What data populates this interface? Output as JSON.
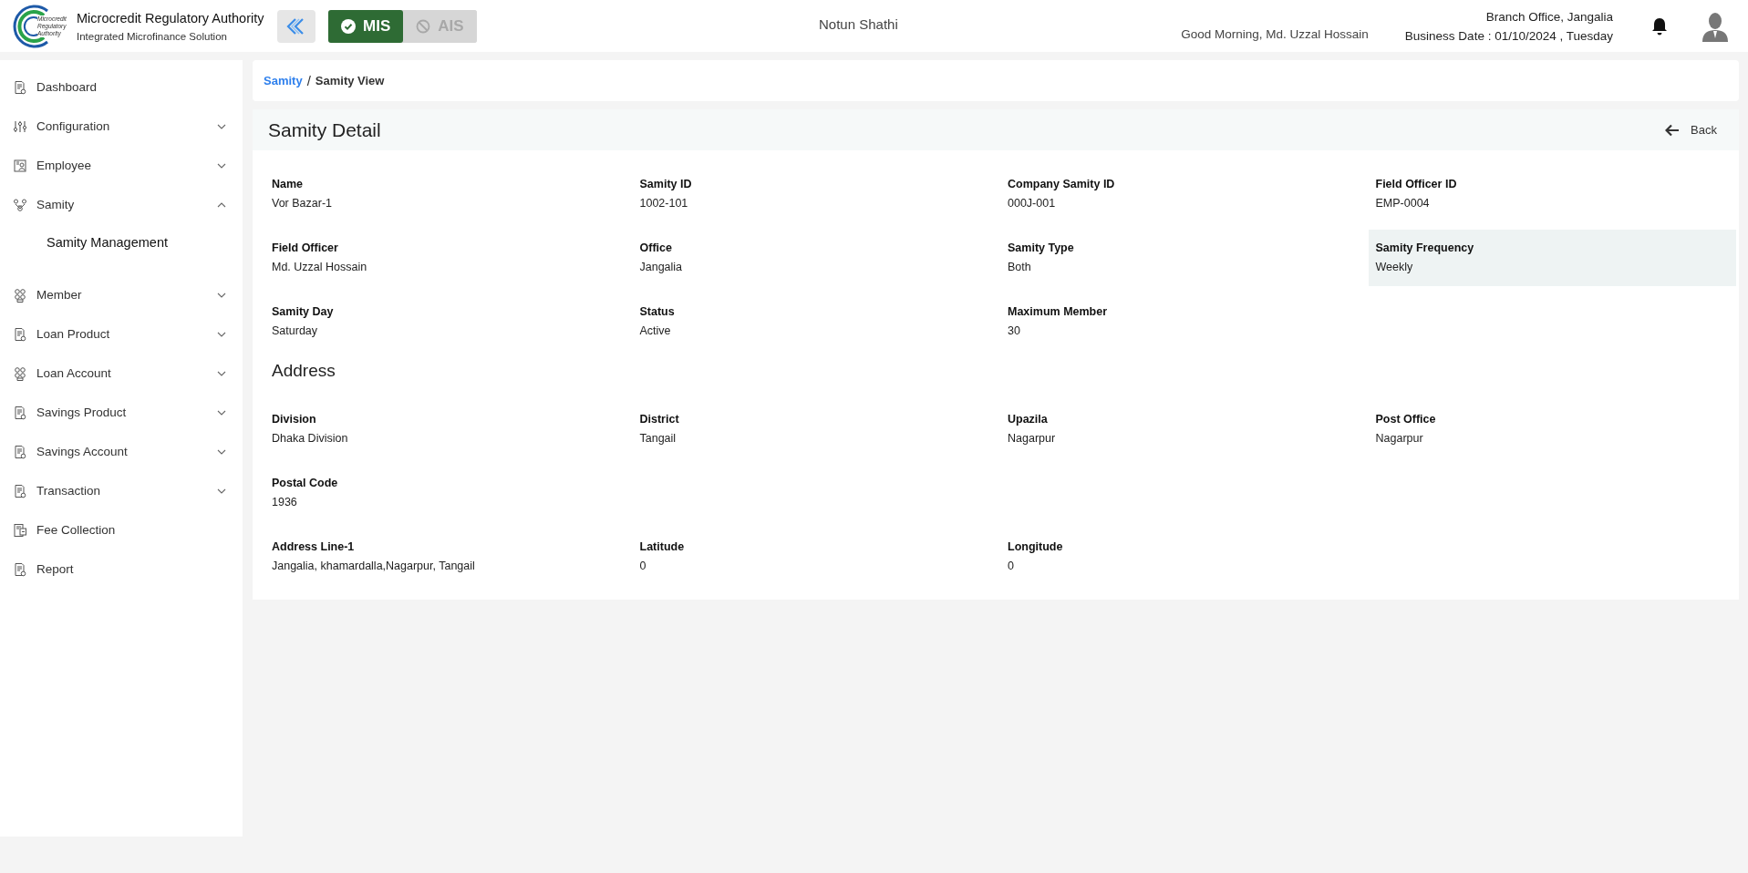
{
  "header": {
    "logo_text": [
      "Microcredit",
      "Regulatory",
      "Authority"
    ],
    "title": "Microcredit Regulatory Authority",
    "subtitle": "Integrated Microfinance Solution",
    "modes": [
      {
        "label": "MIS",
        "selected": true
      },
      {
        "label": "AIS",
        "selected": false
      }
    ],
    "org_name": "Notun Shathi",
    "greeting": "Good Morning, Md. Uzzal Hossain",
    "branch": "Branch Office, Jangalia",
    "business_date": "Business Date : 01/10/2024 , Tuesday"
  },
  "sidebar": {
    "items": [
      {
        "label": "Dashboard",
        "kind": "link"
      },
      {
        "label": "Configuration",
        "kind": "group",
        "expanded": false
      },
      {
        "label": "Employee",
        "kind": "group",
        "expanded": false
      },
      {
        "label": "Samity",
        "kind": "group",
        "expanded": true,
        "children": [
          {
            "label": "Samity Management"
          }
        ]
      },
      {
        "label": "Member",
        "kind": "group",
        "expanded": false
      },
      {
        "label": "Loan Product",
        "kind": "group",
        "expanded": false
      },
      {
        "label": "Loan Account",
        "kind": "group",
        "expanded": false
      },
      {
        "label": "Savings Product",
        "kind": "group",
        "expanded": false
      },
      {
        "label": "Savings Account",
        "kind": "group",
        "expanded": false
      },
      {
        "label": "Transaction",
        "kind": "group",
        "expanded": false
      },
      {
        "label": "Fee Collection",
        "kind": "link"
      },
      {
        "label": "Report",
        "kind": "link"
      }
    ]
  },
  "breadcrumb": {
    "separator": "/",
    "items": [
      {
        "label": "Samity",
        "kind": "link"
      },
      {
        "label": "Samity View",
        "kind": "current"
      }
    ]
  },
  "detail": {
    "title": "Samity Detail",
    "back_label": "Back",
    "sections": [
      {
        "rows": [
          [
            {
              "label": "Name",
              "value": "Vor Bazar-1",
              "highlighted": false
            },
            {
              "label": "Samity ID",
              "value": "1002-101",
              "highlighted": false
            },
            {
              "label": "Company Samity ID",
              "value": "000J-001",
              "highlighted": false
            },
            {
              "label": "Field Officer ID",
              "value": "EMP-0004",
              "highlighted": false
            }
          ],
          [
            {
              "label": "Field Officer",
              "value": "Md. Uzzal Hossain",
              "highlighted": false
            },
            {
              "label": "Office",
              "value": "Jangalia",
              "highlighted": false
            },
            {
              "label": "Samity Type",
              "value": "Both",
              "highlighted": false
            },
            {
              "label": "Samity Frequency",
              "value": "Weekly",
              "highlighted": true
            }
          ],
          [
            {
              "label": "Samity Day",
              "value": "Saturday",
              "highlighted": false
            },
            {
              "label": "Status",
              "value": "Active",
              "highlighted": false
            },
            {
              "label": "Maximum Member",
              "value": "30",
              "highlighted": false
            }
          ]
        ]
      },
      {
        "heading": "Address",
        "rows": [
          [
            {
              "label": "Division",
              "value": "Dhaka Division",
              "highlighted": false
            },
            {
              "label": "District",
              "value": "Tangail",
              "highlighted": false
            },
            {
              "label": "Upazila",
              "value": "Nagarpur",
              "highlighted": false
            },
            {
              "label": "Post Office",
              "value": "Nagarpur",
              "highlighted": false
            }
          ],
          [
            {
              "label": "Postal Code",
              "value": "1936",
              "highlighted": false
            }
          ],
          [
            {
              "label": "Address Line-1",
              "value": "Jangalia, khamardalla,Nagarpur, Tangail",
              "highlighted": false
            },
            {
              "label": "Latitude",
              "value": "0",
              "highlighted": false
            },
            {
              "label": "Longitude",
              "value": "0",
              "highlighted": false
            }
          ]
        ]
      }
    ]
  }
}
